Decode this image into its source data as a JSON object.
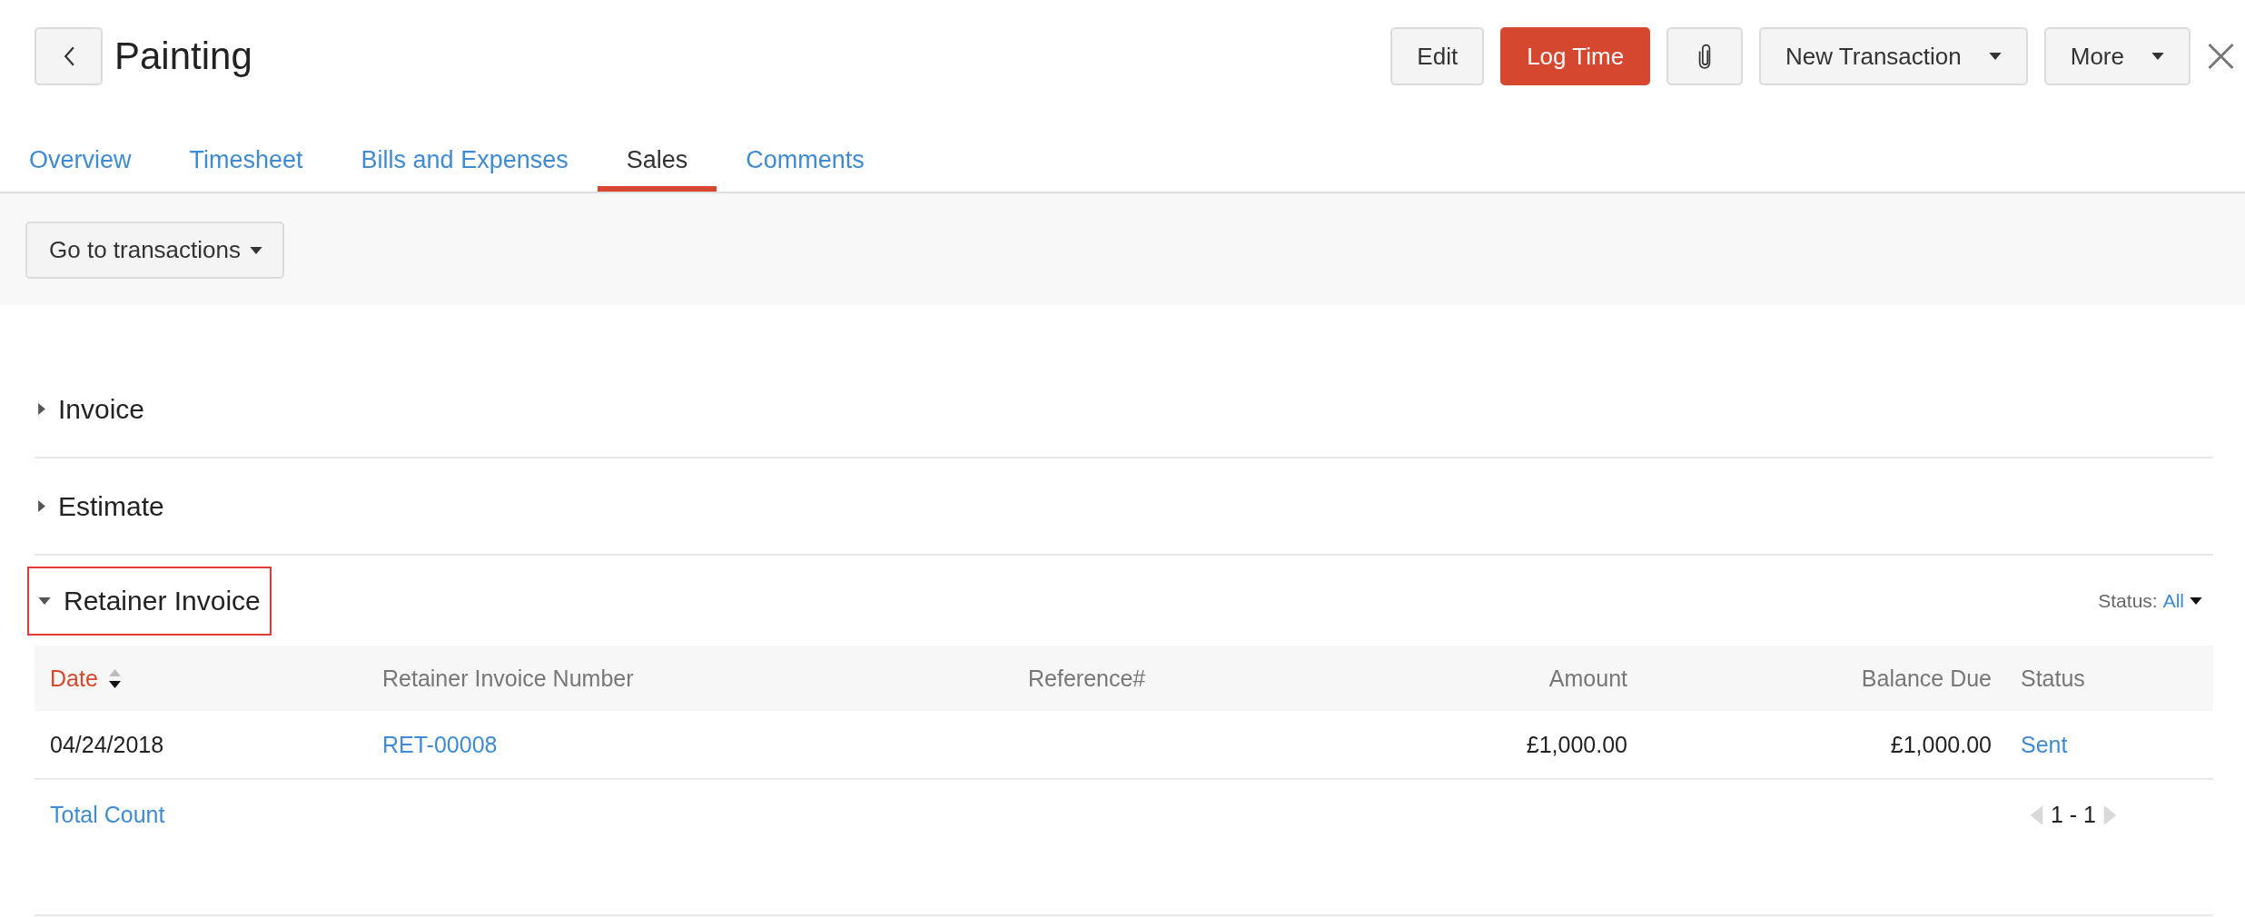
{
  "header": {
    "title": "Painting",
    "actions": [
      {
        "kind": "plain",
        "label": "Edit"
      },
      {
        "kind": "primary",
        "label": "Log Time"
      },
      {
        "kind": "attach"
      },
      {
        "kind": "dropdown",
        "label": "New Transaction"
      },
      {
        "kind": "dropdown",
        "label": "More"
      }
    ]
  },
  "tabs": [
    {
      "label": "Overview",
      "selected": false
    },
    {
      "label": "Timesheet",
      "selected": false
    },
    {
      "label": "Bills and Expenses",
      "selected": false
    },
    {
      "label": "Sales",
      "selected": true
    },
    {
      "label": "Comments",
      "selected": false
    }
  ],
  "toolbar": {
    "menu_label": "Go to transactions"
  },
  "sections": [
    {
      "title": "Invoice",
      "expanded": false,
      "highlighted": false
    },
    {
      "title": "Estimate",
      "expanded": false,
      "highlighted": false
    },
    {
      "title": "Retainer Invoice",
      "expanded": true,
      "highlighted": true,
      "filter": {
        "label": "Status:",
        "value": "All"
      },
      "table": {
        "columns": [
          {
            "label": "Date",
            "kind": "date",
            "sorted": true
          },
          {
            "label": "Retainer Invoice Number",
            "kind": "number",
            "sorted": false
          },
          {
            "label": "Reference#",
            "kind": "reference",
            "sorted": false
          },
          {
            "label": "Amount",
            "kind": "amount",
            "sorted": false
          },
          {
            "label": "Balance Due",
            "kind": "balance",
            "sorted": false
          },
          {
            "label": "Status",
            "kind": "status",
            "sorted": false
          }
        ],
        "rows": [
          {
            "date": "04/24/2018",
            "number": "RET-00008",
            "amount": "£1,000.00",
            "balance": "£1,000.00",
            "status": "Sent"
          }
        ],
        "footer": {
          "total_label": "Total Count",
          "range": "1 - 1",
          "previous_disabled": true,
          "next_disabled": true
        }
      }
    }
  ]
}
